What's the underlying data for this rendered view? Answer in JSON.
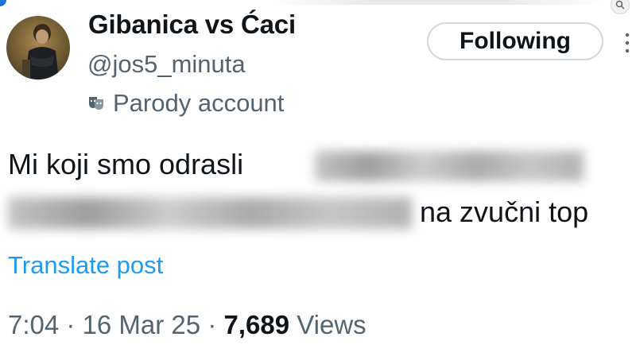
{
  "header": {
    "display_name": "Gibanica vs Ćaci",
    "handle": "@jos5_minuta",
    "account_label": "Parody account",
    "follow_button_label": "Following"
  },
  "tweet": {
    "line1_visible": "Mi koji smo odrasli",
    "line2_visible": "na zvučni top",
    "translate_label": "Translate post"
  },
  "meta": {
    "time": "7:04",
    "separator1": " · ",
    "date": "16 Mar 25",
    "separator2": " · ",
    "views_count": "7,689",
    "views_label": " Views"
  },
  "colors": {
    "text_primary": "#0f1419",
    "text_secondary": "#536471",
    "link": "#1d9bf0",
    "border": "#cfd9de"
  },
  "icons": {
    "parody": "theater-masks-icon",
    "more": "more-vertical-icon",
    "zoom": "magnifier-icon"
  }
}
